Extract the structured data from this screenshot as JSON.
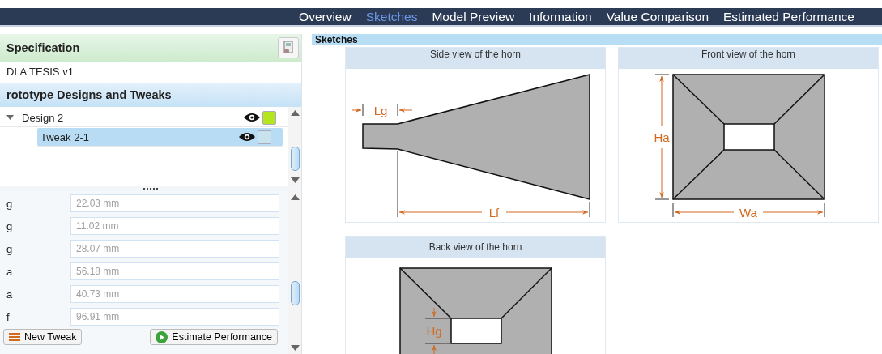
{
  "nav": {
    "tabs": [
      {
        "label": "Overview",
        "selected": false
      },
      {
        "label": "Sketches",
        "selected": true
      },
      {
        "label": "Model Preview",
        "selected": false
      },
      {
        "label": "Information",
        "selected": false
      },
      {
        "label": "Value Comparison",
        "selected": false
      },
      {
        "label": "Estimated Performance",
        "selected": false
      }
    ]
  },
  "specification": {
    "title": "Specification",
    "value": "DLA TESIS v1"
  },
  "prototypes": {
    "title": "rototype Designs and Tweaks",
    "tree": [
      {
        "label": "Design 2",
        "expanded": true,
        "visible": true,
        "color": "#b5e61d",
        "selected": false,
        "children": [
          {
            "label": "Tweak 2-1",
            "visible": true,
            "color": "#c8e2ee",
            "selected": true
          }
        ]
      }
    ]
  },
  "parameters": [
    {
      "label": "g",
      "value": "22.03 mm",
      "disabled": true
    },
    {
      "label": "g",
      "value": "11.02 mm",
      "disabled": true
    },
    {
      "label": "g",
      "value": "28.07 mm",
      "disabled": true
    },
    {
      "label": "a",
      "value": "56.18 mm",
      "disabled": true
    },
    {
      "label": "a",
      "value": "40.73 mm",
      "disabled": true
    },
    {
      "label": "f",
      "value": "96.91 mm",
      "disabled": true
    }
  ],
  "buttons": [
    {
      "label": "New Tweak",
      "kind": "new"
    },
    {
      "label": "Estimate Performance",
      "kind": "estimate"
    }
  ],
  "sketches": {
    "title": "Sketches",
    "cards": [
      {
        "title": "Side view of the horn",
        "kind": "side",
        "labels": [
          "Lg",
          "Lf"
        ]
      },
      {
        "title": "Front view of the horn",
        "kind": "front",
        "labels": [
          "Ha",
          "Wa"
        ]
      },
      {
        "title": "Back view of the horn",
        "kind": "back",
        "labels": [
          "Hg"
        ]
      }
    ]
  }
}
